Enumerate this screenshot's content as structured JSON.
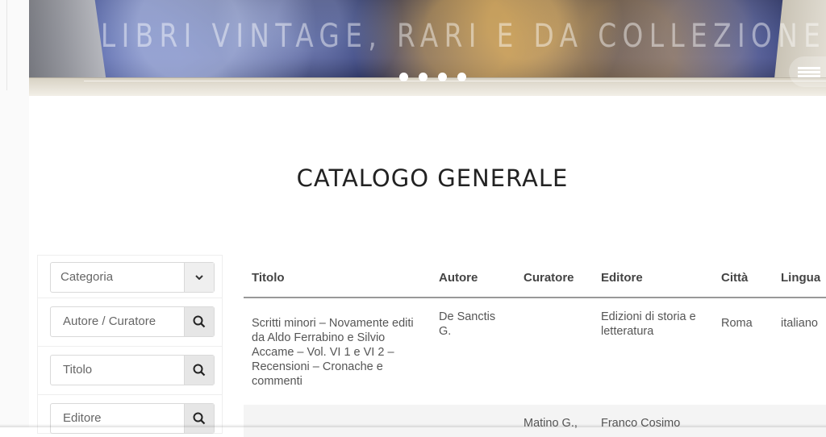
{
  "hero": {
    "title": "LIBRI VINTAGE, RARI E DA COLLEZIONE",
    "slide_count": 4
  },
  "page": {
    "title": "CATALOGO GENERALE"
  },
  "filters": {
    "categoria": "Categoria",
    "autore_curatore": "Autore / Curatore",
    "titolo": "Titolo",
    "editore": "Editore"
  },
  "table": {
    "headers": [
      "Titolo",
      "Autore",
      "Curatore",
      "Editore",
      "Città",
      "Lingua"
    ],
    "rows": [
      {
        "titolo": "Scritti minori – Novamente editi da Aldo Ferrabino e Silvio Accame – Vol. VI 1 e VI 2 – Recensioni – Cronache e commenti",
        "autore": "De Sanctis G.",
        "curatore": "",
        "editore": "Edizioni di storia e letteratura",
        "citta": "Roma",
        "lingua": "italiano"
      },
      {
        "titolo": "",
        "autore": "",
        "curatore": "Matino G.,",
        "editore": "Franco Cosimo",
        "citta": "",
        "lingua": ""
      }
    ]
  },
  "colors": {
    "hero_bg": "#22306a",
    "filter_button": "#e6e6e6",
    "header_rule": "#999999",
    "alt_row": "#f4f4f4"
  },
  "icons": {
    "search": "search-icon",
    "dropdown": "chevron-down-icon",
    "menu": "hamburger-menu-icon"
  }
}
